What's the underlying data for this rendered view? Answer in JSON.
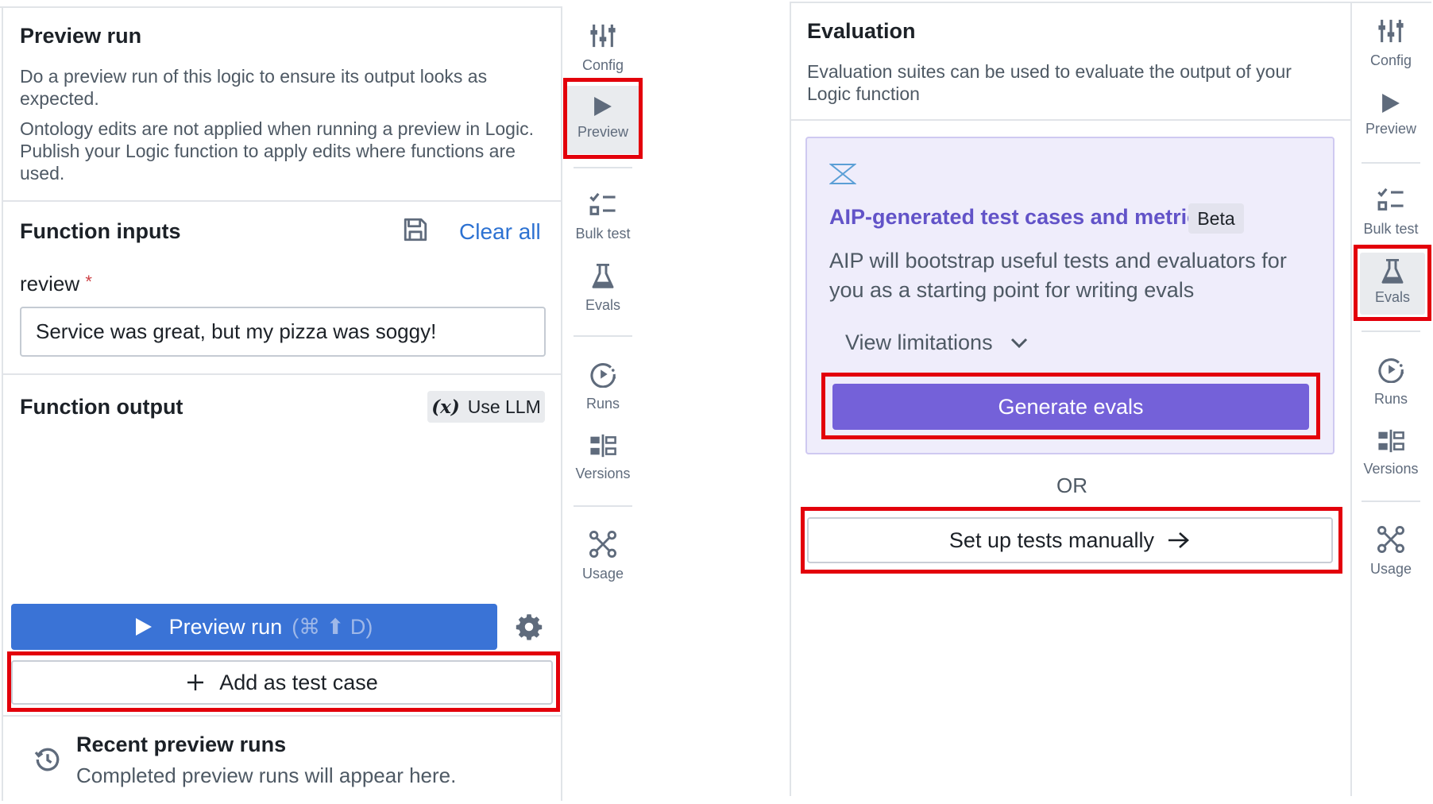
{
  "left_panel": {
    "preview_run": {
      "title": "Preview run",
      "description_1": "Do a preview run of this logic to ensure its output looks as expected.",
      "description_2": "Ontology edits are not applied when running a preview in Logic. Publish your Logic function to apply edits where functions are used."
    },
    "function_inputs": {
      "title": "Function inputs",
      "save_icon": "floppy-disk-icon",
      "clear_all_label": "Clear all",
      "field_label": "review",
      "required_marker": "*",
      "field_value": "Service was great, but my pizza was soggy!"
    },
    "function_output": {
      "title": "Function output",
      "use_llm_symbol": "(x)",
      "use_llm_label": "Use LLM"
    },
    "actions": {
      "preview_run_label": "Preview run",
      "preview_run_shortcut": "(⌘ ⬆ D)",
      "settings_icon": "gear-icon",
      "add_test_case_label": "Add as test case"
    },
    "recent_runs": {
      "title": "Recent preview runs",
      "subtitle": "Completed preview runs will appear here."
    }
  },
  "nav_left": {
    "items": [
      {
        "label": "Config",
        "icon": "sliders-icon"
      },
      {
        "label": "Preview",
        "icon": "play-icon",
        "active": true
      },
      {
        "label": "Bulk test",
        "icon": "checklist-icon"
      },
      {
        "label": "Evals",
        "icon": "flask-icon"
      },
      {
        "label": "Runs",
        "icon": "run-history-icon"
      },
      {
        "label": "Versions",
        "icon": "versions-icon"
      },
      {
        "label": "Usage",
        "icon": "graph-nodes-icon"
      }
    ]
  },
  "right_panel": {
    "title": "Evaluation",
    "description": "Evaluation suites can be used to evaluate the output of your Logic function",
    "aip_card": {
      "logo_icon": "aip-logo-icon",
      "title": "AIP-generated test cases and metrics",
      "badge": "Beta",
      "description": "AIP will bootstrap useful tests and evaluators for you as a starting point for writing evals",
      "view_limitations_label": "View limitations",
      "generate_label": "Generate evals"
    },
    "or_label": "OR",
    "manual_label": "Set up tests manually"
  },
  "nav_right": {
    "items": [
      {
        "label": "Config",
        "icon": "sliders-icon"
      },
      {
        "label": "Preview",
        "icon": "play-icon"
      },
      {
        "label": "Bulk test",
        "icon": "checklist-icon"
      },
      {
        "label": "Evals",
        "icon": "flask-icon",
        "active": true
      },
      {
        "label": "Runs",
        "icon": "run-history-icon"
      },
      {
        "label": "Versions",
        "icon": "versions-icon"
      },
      {
        "label": "Usage",
        "icon": "graph-nodes-icon"
      }
    ]
  },
  "colors": {
    "accent_blue": "#3a73d6",
    "link_blue": "#2d72d2",
    "aip_purple": "#7461d9",
    "aip_card_bg": "#efedfb",
    "highlight_red": "#e3000b"
  }
}
